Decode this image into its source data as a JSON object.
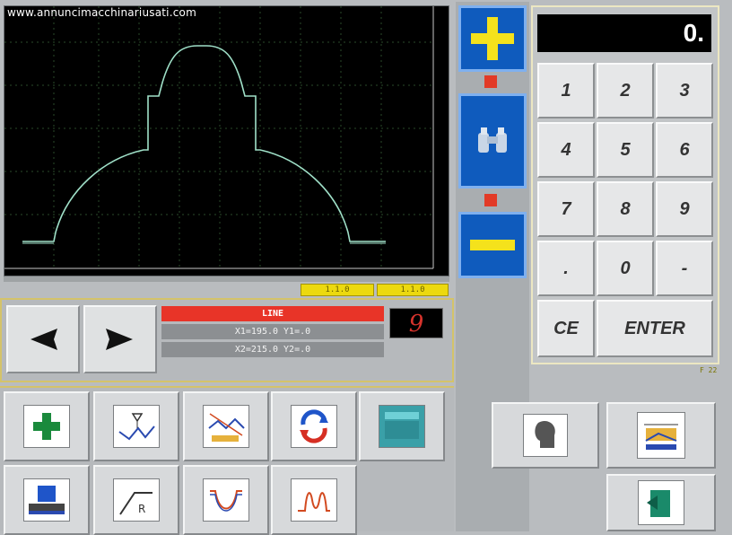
{
  "watermark": "www.annuncimacchinariusati.com",
  "graph": {
    "profile_color": "#9fe0c8",
    "axis_color": "#c8c8c8"
  },
  "tabs": {
    "left_label": "1.1.0",
    "right_label": "1.1.0"
  },
  "program": {
    "line_label": "LINE",
    "line2": "X1=195.0  Y1=.0",
    "line3": "X2=215.0  Y2=.0",
    "number": "9"
  },
  "keypad": {
    "display": "0.",
    "keys": [
      "1",
      "2",
      "3",
      "4",
      "5",
      "6",
      "7",
      "8",
      "9",
      ".",
      "0",
      "-"
    ],
    "ce": "CE",
    "enter": "ENTER"
  },
  "version": "F 22",
  "controls": {
    "plus_icon": "plus-icon",
    "zoom_icon": "binoculars-icon",
    "minus_icon": "minus-icon"
  },
  "colors": {
    "accent_blue": "#0f5bbd",
    "plus_yellow": "#f4e21c",
    "alert_red": "#e83428"
  }
}
